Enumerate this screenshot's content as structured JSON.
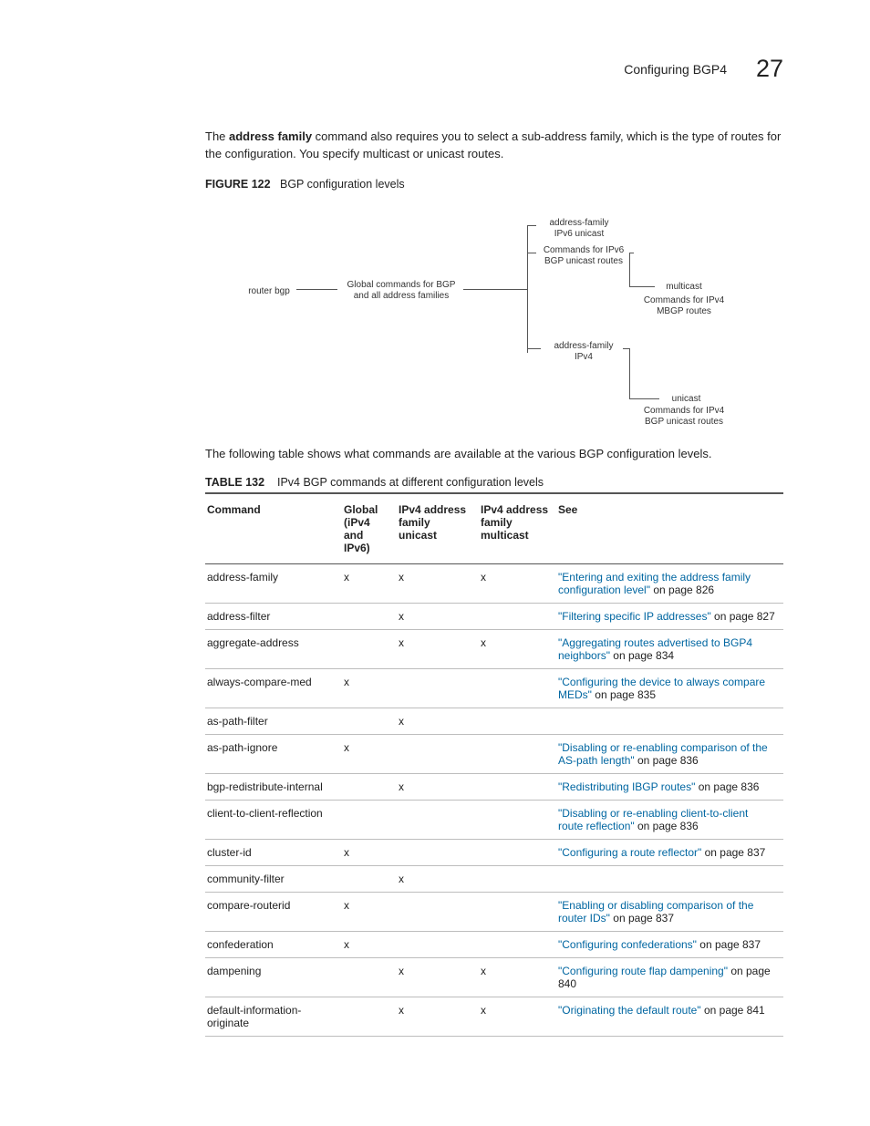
{
  "header": {
    "section": "Configuring BGP4",
    "chapnum": "27"
  },
  "para1_pre": "The ",
  "para1_bold": "address family",
  "para1_post": " command also requires you to select a sub-address family, which is the type of routes for the configuration. You specify multicast or unicast routes.",
  "figure": {
    "num": "FIGURE 122",
    "title": "BGP configuration levels",
    "labels": {
      "router_bgp": "router bgp",
      "global": "Global commands for BGP and all address families",
      "af_ipv6_t": "address-family",
      "af_ipv6_b": "IPv6 unicast",
      "ipv6_cmds_a": "Commands for IPv6",
      "ipv6_cmds_b": "BGP unicast routes",
      "multicast": "multicast",
      "mbgp_a": "Commands for IPv4",
      "mbgp_b": "MBGP routes",
      "af_ipv4_a": "address-family",
      "af_ipv4_b": "IPv4",
      "unicast": "unicast",
      "ipv4_cmds_a": "Commands for IPv4",
      "ipv4_cmds_b": "BGP unicast routes"
    }
  },
  "para2": "The following table shows what commands are available at the various BGP configuration levels.",
  "table": {
    "num": "TABLE 132",
    "title": "IPv4 BGP commands at different configuration levels",
    "headers": {
      "cmd": "Command",
      "global_a": "Global",
      "global_b": "(iPv4 and",
      "global_c": "IPv6)",
      "uni_a": "IPv4 address",
      "uni_b": "family unicast",
      "multi_a": "IPv4 address",
      "multi_b": "family",
      "multi_c": "multicast",
      "see": "See"
    },
    "rows": [
      {
        "cmd": "address-family",
        "g": "x",
        "u": "x",
        "m": "x",
        "link": "\"Entering and exiting the address family configuration level\"",
        "suffix": " on page 826"
      },
      {
        "cmd": "address-filter",
        "g": "",
        "u": "x",
        "m": "",
        "link": "\"Filtering specific IP addresses\"",
        "suffix": " on page 827"
      },
      {
        "cmd": "aggregate-address",
        "g": "",
        "u": "x",
        "m": "x",
        "link": "\"Aggregating routes advertised to BGP4 neighbors\"",
        "suffix": " on page 834"
      },
      {
        "cmd": "always-compare-med",
        "g": "x",
        "u": "",
        "m": "",
        "link": "\"Configuring the device to always compare MEDs\"",
        "suffix": " on page 835"
      },
      {
        "cmd": "as-path-filter",
        "g": "",
        "u": "x",
        "m": "",
        "link": "",
        "suffix": ""
      },
      {
        "cmd": "as-path-ignore",
        "g": "x",
        "u": "",
        "m": "",
        "link": "\"Disabling or re-enabling comparison of the AS-path length\"",
        "suffix": " on page 836"
      },
      {
        "cmd": "bgp-redistribute-internal",
        "g": "",
        "u": "x",
        "m": "",
        "link": "\"Redistributing IBGP routes\"",
        "suffix": " on page 836"
      },
      {
        "cmd": "client-to-client-reflection",
        "g": "",
        "u": "",
        "m": "",
        "link": "\"Disabling or re-enabling client-to-client route reflection\"",
        "suffix": " on page 836"
      },
      {
        "cmd": "cluster-id",
        "g": "x",
        "u": "",
        "m": "",
        "link": "\"Configuring a route reflector\"",
        "suffix": " on page 837"
      },
      {
        "cmd": "community-filter",
        "g": "",
        "u": "x",
        "m": "",
        "link": "",
        "suffix": ""
      },
      {
        "cmd": "compare-routerid",
        "g": "x",
        "u": "",
        "m": "",
        "link": "\"Enabling or disabling comparison of the router IDs\"",
        "suffix": " on page 837"
      },
      {
        "cmd": "confederation",
        "g": "x",
        "u": "",
        "m": "",
        "link": "\"Configuring confederations\"",
        "suffix": " on page 837"
      },
      {
        "cmd": "dampening",
        "g": "",
        "u": "x",
        "m": "x",
        "link": "\"Configuring route flap dampening\"",
        "suffix": " on page 840"
      },
      {
        "cmd": "default-information-originate",
        "g": "",
        "u": "x",
        "m": "x",
        "link": "\"Originating the default route\"",
        "suffix": " on page 841"
      }
    ]
  }
}
